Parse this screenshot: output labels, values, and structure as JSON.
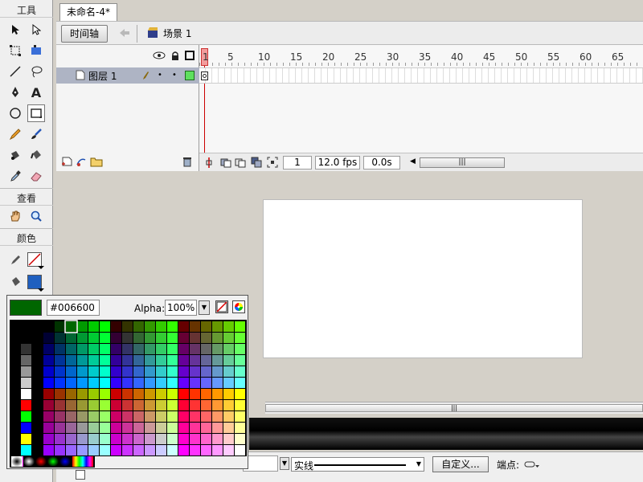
{
  "tools_panel": {
    "title": "工具",
    "view_title": "查看",
    "color_title": "颜色"
  },
  "document_tab": {
    "title": "未命名-4*"
  },
  "timeline": {
    "toggle_label": "时间轴",
    "scene_label": "场景 1",
    "ruler_numbers": [
      "1",
      "5",
      "10",
      "15",
      "20",
      "25",
      "30",
      "35",
      "40",
      "45",
      "50",
      "55",
      "60",
      "65"
    ],
    "layer_name": "图层 1",
    "current_frame": "1",
    "frame_rate": "12.0 fps",
    "elapsed_time": "0.0s"
  },
  "color_picker": {
    "current_hex": "#006600",
    "alpha_label": "Alpha:",
    "alpha_value": "100%",
    "current_color": "#006600"
  },
  "properties": {
    "stroke_style": "实线",
    "custom_button": "自定义...",
    "endpoint_label": "端点:",
    "stroke_color": "#d00000",
    "fill_color": "#1f5fbf"
  }
}
